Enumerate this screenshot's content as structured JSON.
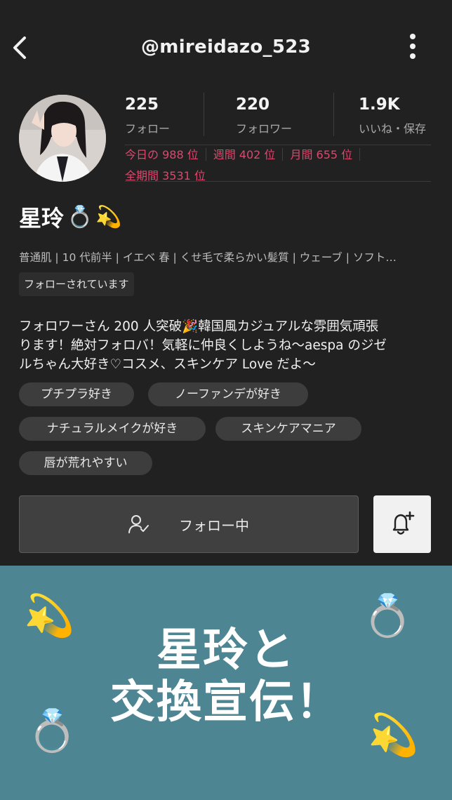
{
  "header": {
    "username": "@mireidazo_523"
  },
  "profile": {
    "stats": [
      {
        "value": "225",
        "label": "フォロー"
      },
      {
        "value": "220",
        "label": "フォロワー"
      },
      {
        "value": "1.9K",
        "label": "いいね・保存"
      }
    ],
    "ranks": {
      "today": "今日の 988 位",
      "weekly": "週間 402 位",
      "monthly": "月間 655 位",
      "all_time": "全期間 3531 位"
    },
    "display_name": "星玲",
    "name_emojis": [
      "💍",
      "💫"
    ],
    "attributes": "普通肌 | 10 代前半 | イエベ 春 | くせ毛で柔らかい髪質 | ウェーブ | ソフト…",
    "followed_badge": "フォローされています",
    "bio_line1": "フォロワーさん 200 人突破🎉韓国風カジュアルな雰囲気頑張",
    "bio_line2": "ります！絶対フォロバ！気軽に仲良くしようね〜aespa のジゼ",
    "bio_line3": "ルちゃん大好き♡コスメ、スキンケア Love だよ〜",
    "tags": [
      "プチプラ好き",
      "ノーファンデが好き",
      "ナチュラルメイクが好き",
      "スキンケアマニア",
      "唇が荒れやすい"
    ]
  },
  "actions": {
    "follow_label": "フォロー中"
  },
  "banner": {
    "line1": "星玲と",
    "line2": "交換宣伝！",
    "emojis": [
      "💫",
      "💍",
      "💍",
      "💫"
    ],
    "background": "#4d8592"
  },
  "colors": {
    "background": "#212121",
    "rank_accent": "#e0466e"
  },
  "icons": {
    "back": "chevron-left-icon",
    "more": "more-vertical-icon",
    "follow": "user-check-icon",
    "bell": "bell-plus-icon"
  }
}
